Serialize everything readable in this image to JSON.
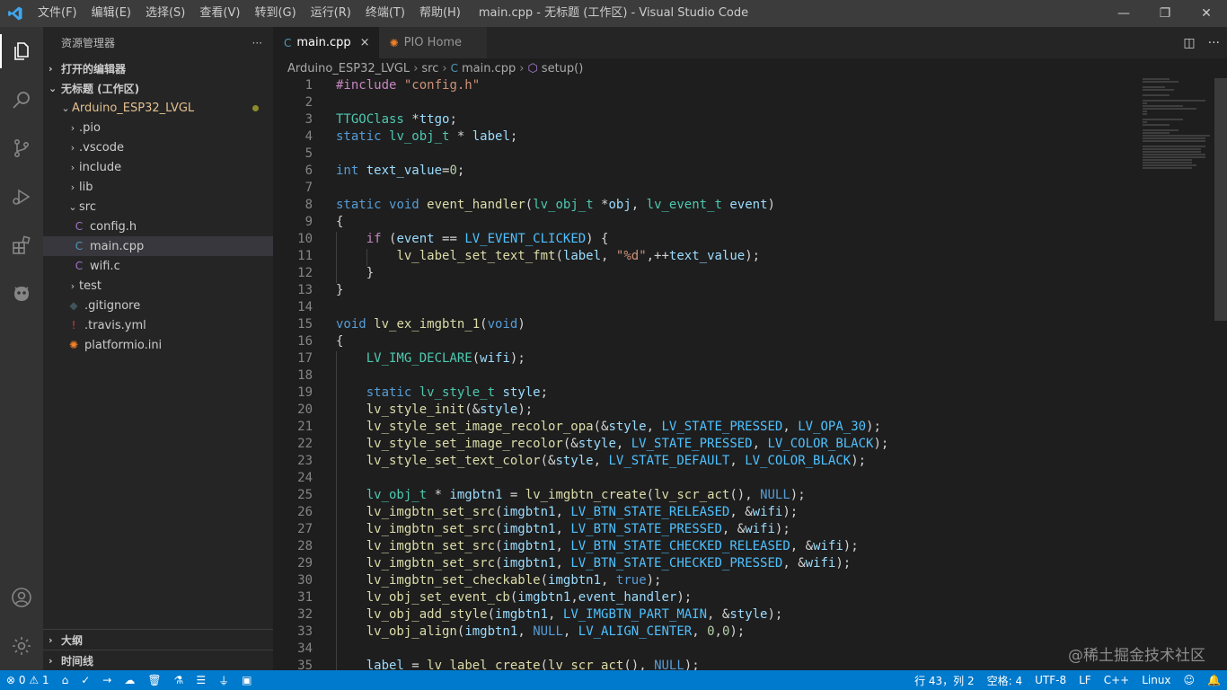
{
  "window": {
    "title": "main.cpp - 无标题 (工作区) - Visual Studio Code",
    "menu": [
      "文件(F)",
      "编辑(E)",
      "选择(S)",
      "查看(V)",
      "转到(G)",
      "运行(R)",
      "终端(T)",
      "帮助(H)"
    ]
  },
  "activity_bar": {
    "top": [
      "files-icon",
      "search-icon",
      "source-control-icon",
      "run-debug-icon",
      "extensions-icon",
      "platformio-icon"
    ],
    "bottom": [
      "account-icon",
      "settings-gear-icon"
    ]
  },
  "sidebar": {
    "title": "资源管理器",
    "more": "···",
    "open_editors": "打开的编辑器",
    "workspace": "无标题 (工作区)",
    "project": "Arduino_ESP32_LVGL",
    "tree": [
      {
        "label": ".pio",
        "type": "folder",
        "indent": 1
      },
      {
        "label": ".vscode",
        "type": "folder",
        "indent": 1
      },
      {
        "label": "include",
        "type": "folder",
        "indent": 1
      },
      {
        "label": "lib",
        "type": "folder",
        "indent": 1
      },
      {
        "label": "src",
        "type": "folder-open",
        "indent": 1
      },
      {
        "label": "config.h",
        "type": "c",
        "indent": 2
      },
      {
        "label": "main.cpp",
        "type": "cpp",
        "indent": 2
      },
      {
        "label": "wifi.c",
        "type": "c",
        "indent": 2
      },
      {
        "label": "test",
        "type": "folder",
        "indent": 1
      },
      {
        "label": ".gitignore",
        "type": "git",
        "indent": 1
      },
      {
        "label": ".travis.yml",
        "type": "yml",
        "indent": 1
      },
      {
        "label": "platformio.ini",
        "type": "pio",
        "indent": 1
      }
    ],
    "outline": "大纲",
    "timeline": "时间线"
  },
  "tabs": [
    {
      "label": "main.cpp",
      "icon": "C",
      "active": true,
      "close": "×"
    },
    {
      "label": "PIO Home",
      "icon": "✺",
      "active": false,
      "close": ""
    }
  ],
  "breadcrumb": [
    "Arduino_ESP32_LVGL",
    "src",
    "main.cpp",
    "setup()"
  ],
  "code_lines": [
    "1",
    "2",
    "3",
    "4",
    "5",
    "6",
    "7",
    "8",
    "9",
    "10",
    "11",
    "12",
    "13",
    "14",
    "15",
    "16",
    "17",
    "18",
    "19",
    "20",
    "21",
    "22",
    "23",
    "24",
    "25",
    "26",
    "27",
    "28",
    "29",
    "30",
    "31",
    "32",
    "33",
    "34",
    "35"
  ],
  "watermark": "@稀土掘金技术社区",
  "status": {
    "errors": "0",
    "warnings": "1",
    "position": "行 43，列 2",
    "spaces": "空格: 4",
    "encoding": "UTF-8",
    "eol": "LF",
    "language": "C++",
    "platform": "Linux"
  }
}
